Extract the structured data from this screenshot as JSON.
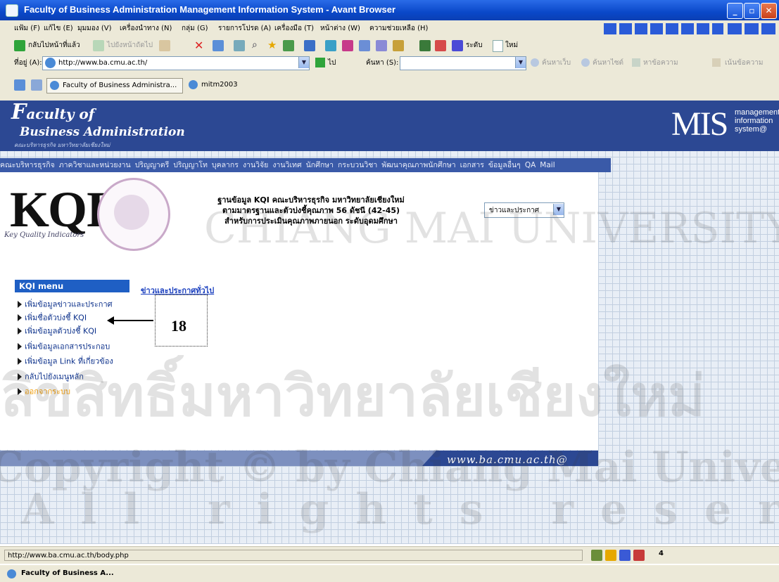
{
  "window": {
    "title": "Faculty of Business Administration Management Information System - Avant Browser"
  },
  "menu": [
    "แฟ้ม (F)",
    "แก้ไข (E)",
    "มุมมอง (V)",
    "เครื่องนำทาง (N)",
    "กลุ่ม (G)",
    "รายการโปรด (A)",
    "เครื่องมือ (T)",
    "หน้าต่าง (W)",
    "ความช่วยเหลือ (H)"
  ],
  "toolbar": {
    "back": "กลับไปหน้าที่แล้ว",
    "forward": "ไปยังหน้าถัดไป",
    "sync": "ระดับ",
    "new": "ใหม่"
  },
  "address": {
    "label": "ที่อยู่ (A):",
    "url": "http://www.ba.cmu.ac.th/",
    "go": "ไป",
    "search_label": "ค้นหา (S):",
    "search_web": "ค้นหาเว็บ",
    "search_site": "ค้นหาไซต์",
    "find_text": "หาข้อความ",
    "highlight": "เน้นข้อความ"
  },
  "tabs": [
    "Faculty of Business Administra...",
    "mitm2003"
  ],
  "banner": {
    "logo_line1": "aculty of",
    "logo_line2": "Business Administration",
    "logo_thai": "คณะบริหารธุรกิจ มหาวิทยาลัยเชียงใหม่",
    "mis": "MIS",
    "mis_sub1": "management",
    "mis_sub2": "information",
    "mis_sub3": "system@"
  },
  "nav": [
    "คณะบริหารธุรกิจ",
    "ภาควิชาและหน่วยงาน",
    "ปริญญาตรี",
    "ปริญญาโท",
    "บุคลากร",
    "งานวิจัย",
    "งานวิเทศ",
    "นักศึกษา",
    "กระบวนวิชา",
    "พัฒนาคุณภาพนักศึกษา",
    "เอกสาร",
    "ข้อมูลอื่นๆ",
    "QA",
    "Mail"
  ],
  "kqi": {
    "title": "KQI",
    "subtitle": "Key Quality Indicators",
    "heading_line1": "ฐานข้อมูล KQI คณะบริหารธุรกิจ มหาวิทยาลัยเชียงใหม่",
    "heading_line2": "ตามมาตรฐานและตัวบ่งชี้คุณภาพ 56 ดัชนี (42-45)",
    "heading_line3": "สำหรับการประเมินคุณภาพภายนอก ระดับอุดมศึกษา",
    "select_value": "ข่าวและประกาศ"
  },
  "sidebar": {
    "header": "KQI menu",
    "items": [
      {
        "label": "เพิ่มข้อมูลข่าวและประกาศ"
      },
      {
        "label": "เพิ่มชื่อตัวบ่งชี้ KQI"
      },
      {
        "label": "เพิ่มข้อมูลตัวบ่งชี้ KQI"
      },
      {
        "label": "เพิ่มข้อมูลเอกสารประกอบ"
      },
      {
        "label": "เพิ่มข้อมูล Link ที่เกี่ยวข้อง"
      },
      {
        "label": "กลับไปยังเมนูหลัก"
      },
      {
        "label": "ออกจากระบบ"
      }
    ]
  },
  "main": {
    "news_link": "ข่าวและประกาศทั่วไป",
    "callout_number": "18"
  },
  "footer": {
    "site": "www.ba.cmu.ac.th@"
  },
  "watermark": {
    "line1": "ลิขสิทธิ์มหาวิทยาลัยเชียงใหม่",
    "line2": "Copyright © by Chiang Mai University",
    "line3": "All rights reserved",
    "seal_text": "CHIANG MAI UNIVERSITY"
  },
  "status": {
    "url": "http://www.ba.cmu.ac.th/body.php",
    "count": "4"
  },
  "taskbar": {
    "button": "Faculty of Business A..."
  },
  "colors": {
    "banner": "#2c4893",
    "nav": "#3a5aa8",
    "menu_header": "#1f5fc4",
    "logout": "#f29b00"
  }
}
